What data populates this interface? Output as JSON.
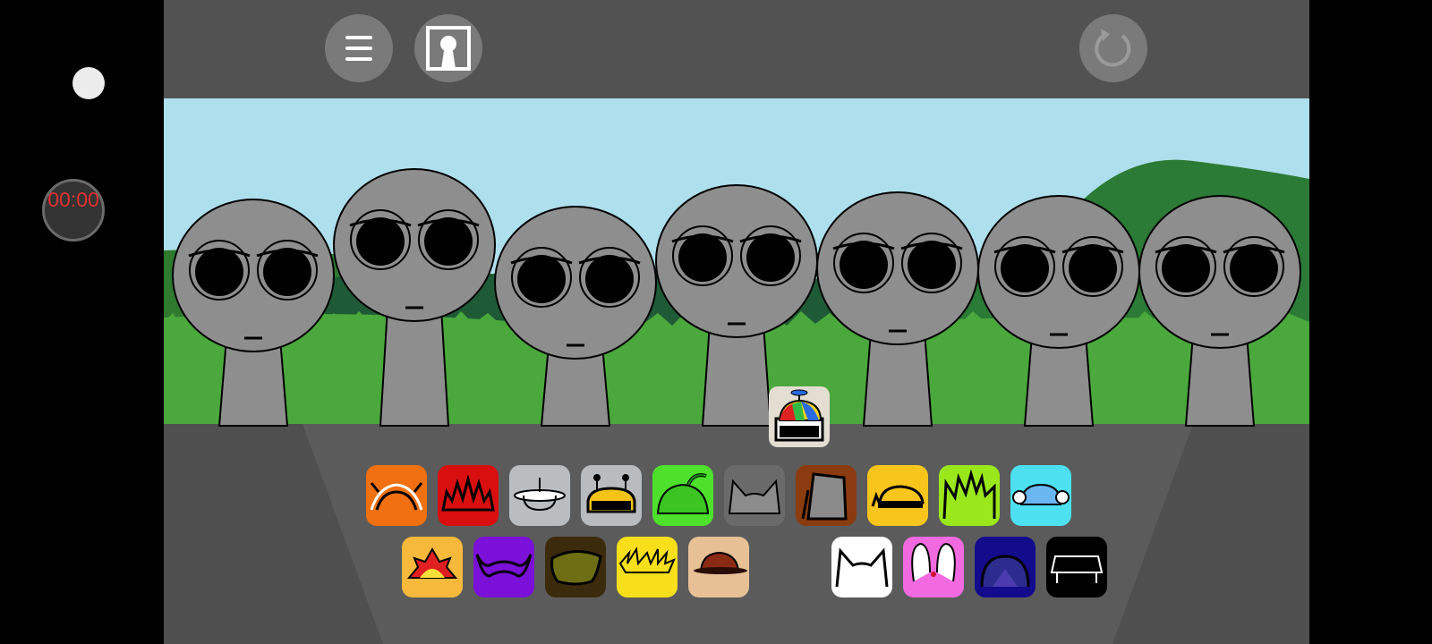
{
  "timer": {
    "text": "00:00"
  },
  "toolbar": {
    "menu_icon": "hamburger-menu-icon",
    "portrait_icon": "portrait-frame-icon",
    "reset_icon": "refresh-icon"
  },
  "characters": {
    "count": 7,
    "color": "#8e8e8e"
  },
  "selected_accessory": {
    "icon": "propeller-beanie-icon"
  },
  "accessory_tray": {
    "row1": [
      {
        "name": "orange-antennae-icon",
        "color": "#f07012"
      },
      {
        "name": "red-spiky-crown-icon",
        "color": "#d90f0f"
      },
      {
        "name": "silver-disc-icon",
        "color": "#b9bdc0"
      },
      {
        "name": "antenna-helmet-icon",
        "color": "#b8bcbf"
      },
      {
        "name": "green-melon-icon",
        "color": "#4ee12c"
      },
      {
        "name": "gray-cat-ears-icon",
        "color": "#6a6a6a"
      },
      {
        "name": "bucket-hat-icon",
        "color": "#8a3c10"
      },
      {
        "name": "yellow-cap-icon",
        "color": "#f7c51b"
      },
      {
        "name": "lime-spiky-hair-icon",
        "color": "#9ae81c"
      },
      {
        "name": "headphones-icon",
        "color": "#4ce0f0"
      }
    ],
    "row2": [
      {
        "name": "sun-crown-icon",
        "color": "#f6b93c"
      },
      {
        "name": "purple-horns-icon",
        "color": "#7b10d8"
      },
      {
        "name": "olive-hair-icon",
        "color": "#3c2a0c"
      },
      {
        "name": "lightning-crown-icon",
        "color": "#f7e01b"
      },
      {
        "name": "brown-fedora-icon",
        "color": "#e7c195"
      },
      {
        "name": "white-cat-ears-icon",
        "color": "#ffffff"
      },
      {
        "name": "bunny-ears-icon",
        "color": "#f26adf"
      },
      {
        "name": "navy-dome-icon",
        "color": "#140a8c"
      },
      {
        "name": "black-frame-icon",
        "color": "#000000"
      }
    ]
  }
}
